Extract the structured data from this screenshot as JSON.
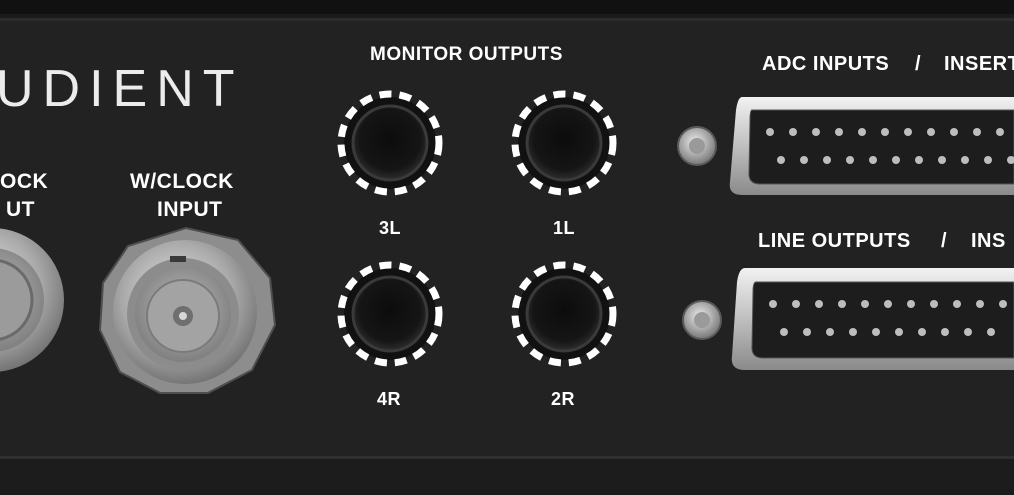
{
  "brand": {
    "text": "UDIENT"
  },
  "wordclock_left": {
    "line1": "OCK",
    "line2": "UT"
  },
  "wordclock_input": {
    "line1": "W/CLOCK",
    "line2": "INPUT"
  },
  "monitor_outputs": {
    "title": "MONITOR OUTPUTS",
    "jacks": [
      {
        "label": "3L"
      },
      {
        "label": "1L"
      },
      {
        "label": "4R"
      },
      {
        "label": "2R"
      }
    ]
  },
  "adc": {
    "label_a": "ADC INPUTS",
    "sep": "/",
    "label_b": "INSERT"
  },
  "line_outputs": {
    "label_a": "LINE OUTPUTS",
    "sep": "/",
    "label_b": "INS"
  },
  "colors": {
    "panel": "#222222",
    "text": "#ffffff",
    "highlight_ring": "#ffffff"
  }
}
